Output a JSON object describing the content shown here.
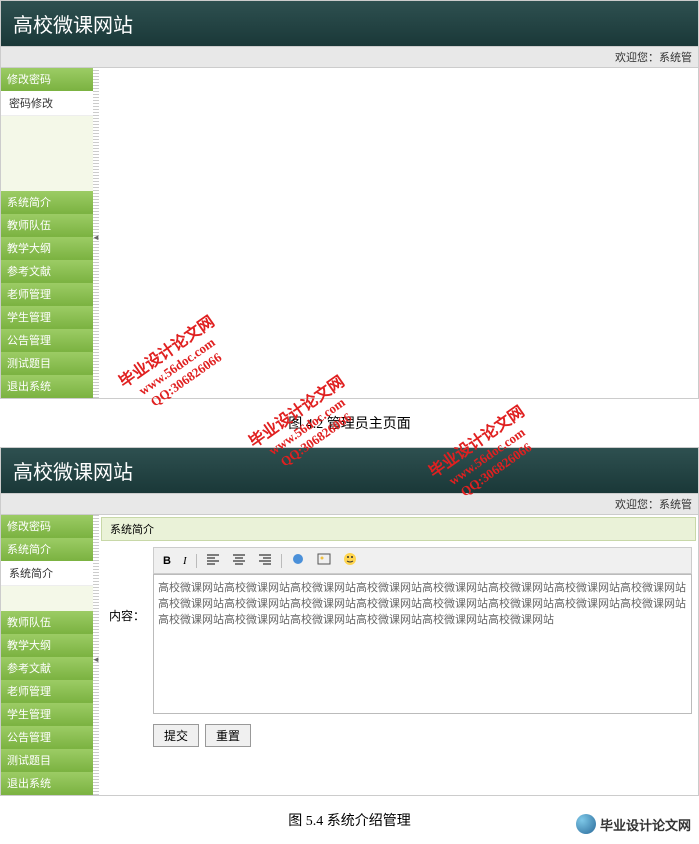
{
  "site_title": "高校微课网站",
  "welcome_prefix": "欢迎您：",
  "welcome_user": "系统管",
  "screenshot1": {
    "sidebar": {
      "top_items": [
        "修改密码"
      ],
      "sub_item": "密码修改",
      "bottom_items": [
        "系统简介",
        "教师队伍",
        "教学大纲",
        "参考文献",
        "老师管理",
        "学生管理",
        "公告管理",
        "测试题目",
        "退出系统"
      ]
    }
  },
  "caption1": "图 4.2 管理员主页面",
  "screenshot2": {
    "sidebar": {
      "top_items": [
        "修改密码",
        "系统简介"
      ],
      "sub_item": "系统简介",
      "bottom_items": [
        "教师队伍",
        "教学大纲",
        "参考文献",
        "老师管理",
        "学生管理",
        "公告管理",
        "测试题目",
        "退出系统"
      ]
    },
    "panel_title": "系统简介",
    "form_label": "内容：",
    "toolbar": {
      "bold": "B",
      "italic": "I"
    },
    "textarea_value": "高校微课网站高校微课网站高校微课网站高校微课网站高校微课网站高校微课网站高校微课网站高校微课网站高校微课网站高校微课网站高校微课网站高校微课网站高校微课网站高校微课网站高校微课网站高校微课网站高校微课网站高校微课网站高校微课网站高校微课网站高校微课网站高校微课网站",
    "submit": "提交",
    "reset": "重置"
  },
  "caption2": "图 5.4 系统介绍管理",
  "watermark": {
    "line1": "毕业设计论文网",
    "line2": "www.56doc.com",
    "line3": "QQ:306826066"
  },
  "footer_logo_text": "毕业设计论文网"
}
